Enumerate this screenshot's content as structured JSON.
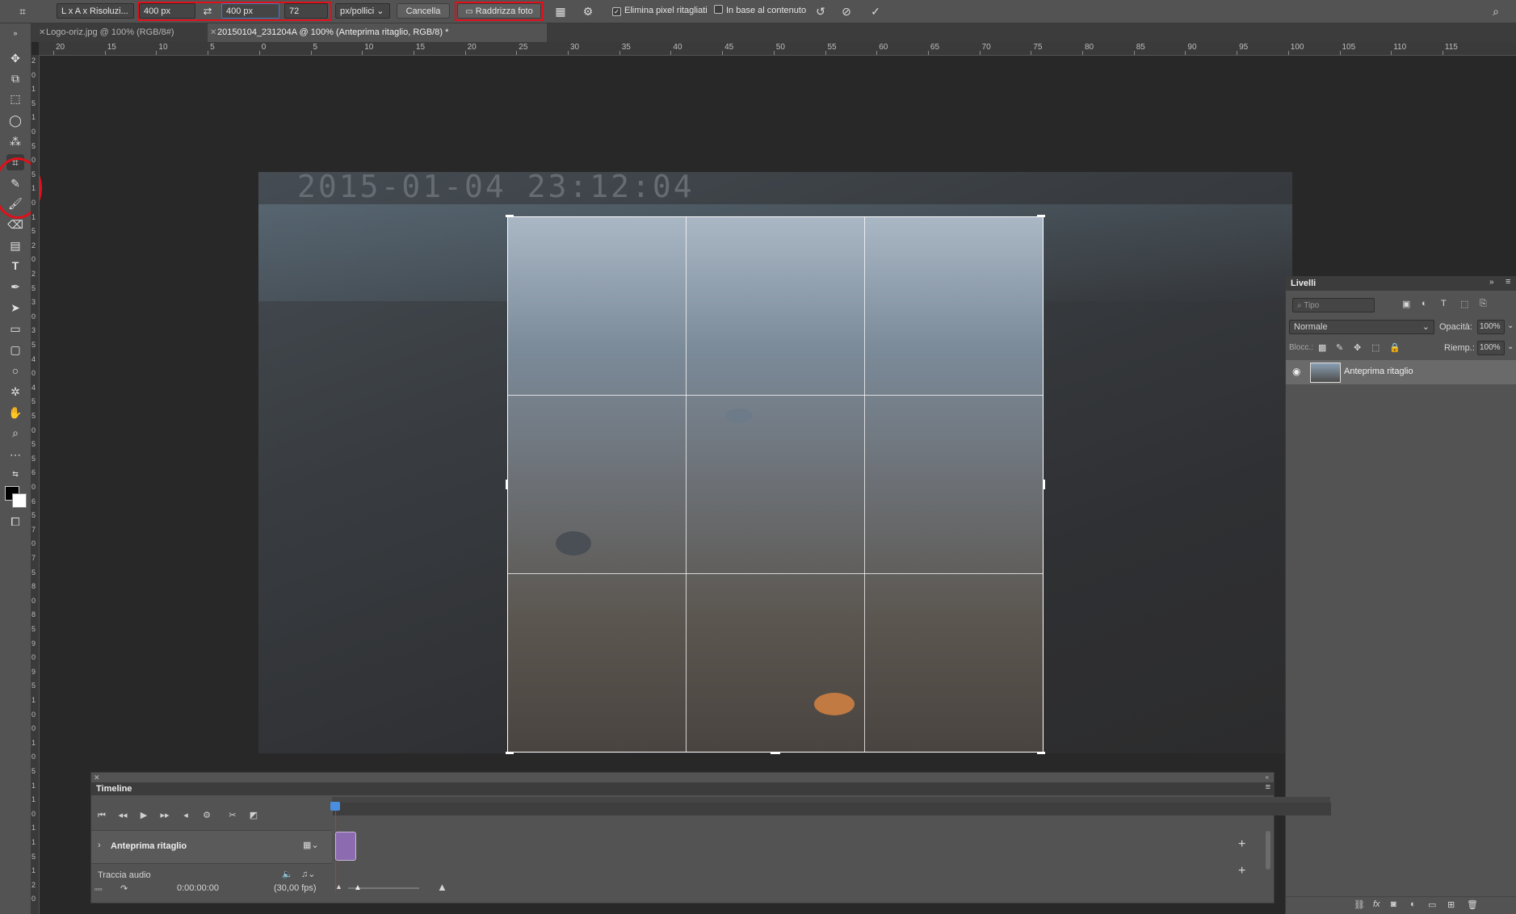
{
  "options_bar": {
    "preset": "L x A x Risoluzi...",
    "width": "400 px",
    "height": "400 px",
    "resolution": "72",
    "unit": "px/pollici",
    "cancel": "Cancella",
    "straighten": "Raddrizza foto",
    "delete_cropped": "Elimina pixel ritagliati",
    "delete_cropped_checked": true,
    "content_aware": "In base al contenuto",
    "content_aware_checked": false
  },
  "tabs": [
    {
      "label": "Logo-oriz.jpg @ 100% (RGB/8#)",
      "active": false
    },
    {
      "label": "20150104_231204A @ 100% (Anteprima ritaglio, RGB/8) *",
      "active": true
    }
  ],
  "ruler_top": [
    "20",
    "15",
    "10",
    "5",
    "0",
    "5",
    "10",
    "15",
    "20",
    "25",
    "30",
    "35",
    "40",
    "45",
    "50",
    "55",
    "60",
    "65",
    "70",
    "75",
    "80",
    "85",
    "90",
    "95",
    "100",
    "105",
    "110",
    "115"
  ],
  "ruler_left": [
    "2",
    "0",
    "1",
    "5",
    "1",
    "0",
    "5",
    "0",
    "5",
    "1",
    "0",
    "1",
    "5",
    "2",
    "0",
    "2",
    "5",
    "3",
    "0",
    "3",
    "5",
    "4",
    "0",
    "4",
    "5",
    "5",
    "0",
    "5",
    "5",
    "6",
    "0",
    "6",
    "5",
    "7",
    "0",
    "7",
    "5",
    "8",
    "0",
    "8",
    "5",
    "9",
    "0",
    "9",
    "5",
    "1",
    "0",
    "0",
    "1",
    "0",
    "5",
    "1",
    "1",
    "0",
    "1",
    "1",
    "5",
    "1",
    "2",
    "0"
  ],
  "canvas": {
    "timestamp": "2015-01-04  23:12:04"
  },
  "layers": {
    "title": "Livelli",
    "search_placeholder": "Tipo",
    "blend_mode": "Normale",
    "opacity_label": "Opacità:",
    "opacity": "100%",
    "lock_label": "Blocc.:",
    "fill_label": "Riemp.:",
    "fill": "100%",
    "items": [
      {
        "name": "Anteprima ritaglio",
        "visible": true
      }
    ]
  },
  "timeline": {
    "title": "Timeline",
    "track": "Anteprima ritaglio",
    "audio_track": "Traccia audio",
    "timecode": "0:00:00:00",
    "fps": "(30,00 fps)"
  },
  "colors": {
    "highlight": "#e0101a",
    "clip": "#8c6bb1",
    "playhead": "#4a8ee0"
  }
}
